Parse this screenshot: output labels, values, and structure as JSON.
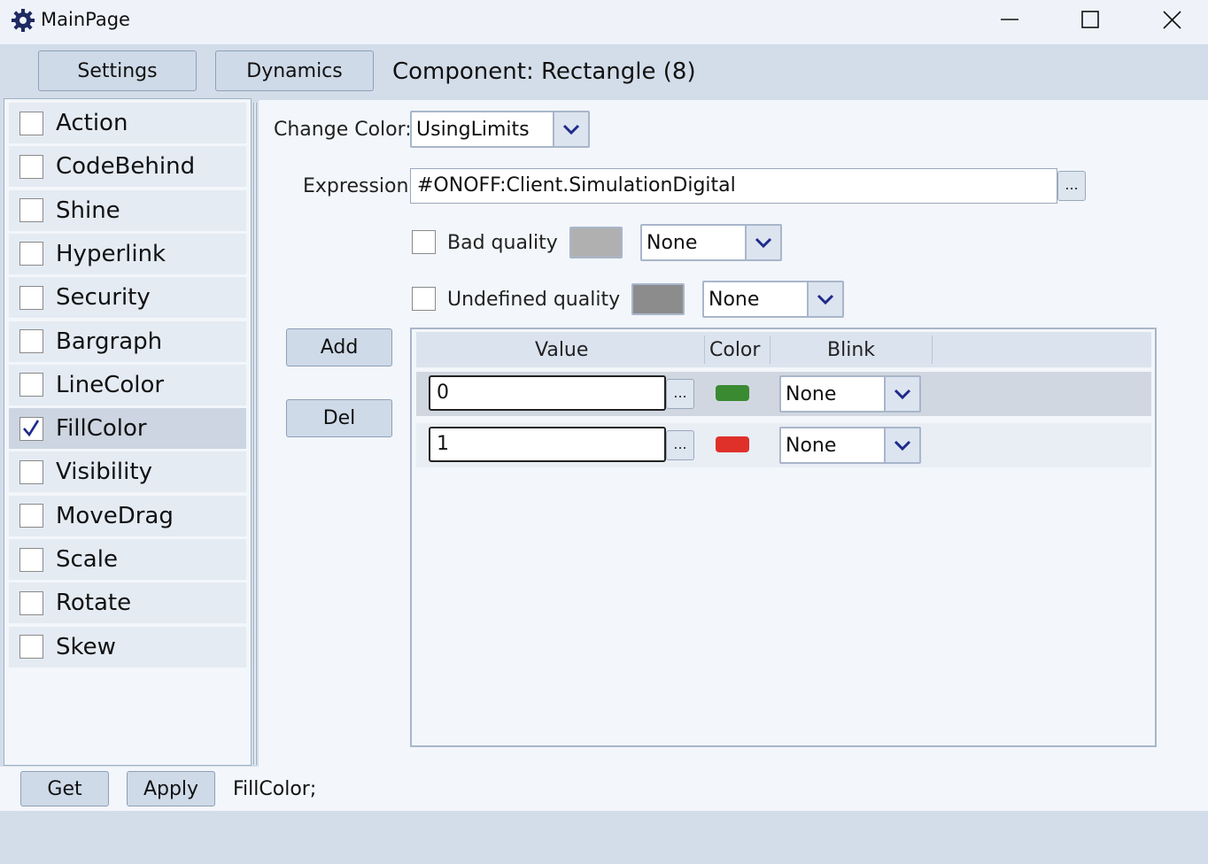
{
  "window": {
    "title": "MainPage"
  },
  "toolbar": {
    "settings_label": "Settings",
    "dynamics_label": "Dynamics",
    "component_title": "Component: Rectangle (8)"
  },
  "dynamics_list": [
    {
      "label": "Action",
      "checked": false
    },
    {
      "label": "CodeBehind",
      "checked": false
    },
    {
      "label": "Shine",
      "checked": false
    },
    {
      "label": "Hyperlink",
      "checked": false
    },
    {
      "label": "Security",
      "checked": false
    },
    {
      "label": "Bargraph",
      "checked": false
    },
    {
      "label": "LineColor",
      "checked": false
    },
    {
      "label": "FillColor",
      "checked": true
    },
    {
      "label": "Visibility",
      "checked": false
    },
    {
      "label": "MoveDrag",
      "checked": false
    },
    {
      "label": "Scale",
      "checked": false
    },
    {
      "label": "Rotate",
      "checked": false
    },
    {
      "label": "Skew",
      "checked": false
    }
  ],
  "fill_color": {
    "change_color_label": "Change Color:",
    "change_color_value": "UsingLimits",
    "expression_label": "Expression:",
    "expression_value": "#ONOFF:Client.SimulationDigital",
    "ellipsis": "...",
    "bad_quality": {
      "label": "Bad quality",
      "checked": false,
      "color": "#b0b0b0",
      "blink": "None"
    },
    "undefined_quality": {
      "label": "Undefined quality",
      "checked": false,
      "color": "#8c8c8c",
      "blink": "None"
    },
    "add_label": "Add",
    "del_label": "Del",
    "columns": {
      "value": "Value",
      "color": "Color",
      "blink": "Blink"
    },
    "rows": [
      {
        "value": "0",
        "color": "#3a8a32",
        "blink": "None",
        "selected": true
      },
      {
        "value": "1",
        "color": "#e0302a",
        "blink": "None",
        "selected": false
      }
    ]
  },
  "footer": {
    "get_label": "Get",
    "apply_label": "Apply",
    "status": "FillColor;"
  }
}
